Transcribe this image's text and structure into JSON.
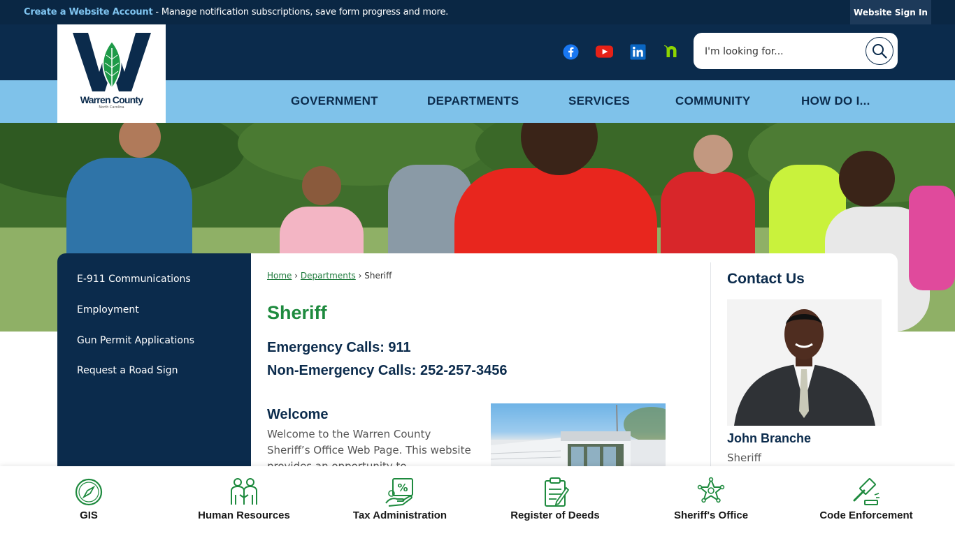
{
  "topbar": {
    "create_link": "Create a Website Account",
    "message": " - Manage notification subscriptions, save form progress and more.",
    "signin_label": "Website Sign In"
  },
  "header": {
    "logo_name": "Warren County",
    "logo_sub": "North Carolina",
    "social_icons": [
      "facebook-icon",
      "youtube-icon",
      "linkedin-icon",
      "nextdoor-icon"
    ],
    "search_placeholder": "I'm looking for..."
  },
  "nav": {
    "items": [
      "GOVERNMENT",
      "DEPARTMENTS",
      "SERVICES",
      "COMMUNITY",
      "HOW DO I..."
    ]
  },
  "sidenav": {
    "items": [
      "E-911 Communications",
      "Employment",
      "Gun Permit Applications",
      "Request a Road Sign"
    ]
  },
  "breadcrumb": {
    "home": "Home",
    "sep1": "›",
    "departments": "Departments",
    "sep2": "›",
    "current": "Sheriff"
  },
  "main": {
    "title": "Sheriff",
    "emergency": "Emergency Calls: 911",
    "non_emergency": "Non-Emergency Calls: 252-257-3456",
    "welcome_title": "Welcome",
    "welcome_text": "Welcome to the Warren County Sheriff’s Office Web Page. This website provides an opportunity to"
  },
  "contact": {
    "title": "Contact Us",
    "name": "John Branche",
    "role": "Sheriff"
  },
  "quicklinks": [
    {
      "label": "GIS",
      "icon": "compass-icon"
    },
    {
      "label": "Human Resources",
      "icon": "people-icon"
    },
    {
      "label": "Tax Administration",
      "icon": "tax-icon"
    },
    {
      "label": "Register of Deeds",
      "icon": "deeds-icon"
    },
    {
      "label": "Sheriff's Office",
      "icon": "sheriff-star-icon"
    },
    {
      "label": "Code Enforcement",
      "icon": "gavel-icon"
    }
  ],
  "colors": {
    "navy": "#0b2b4c",
    "nav_blue": "#7fc2ea",
    "green": "#1e8a3e",
    "link_blue": "#7fc4f0"
  }
}
